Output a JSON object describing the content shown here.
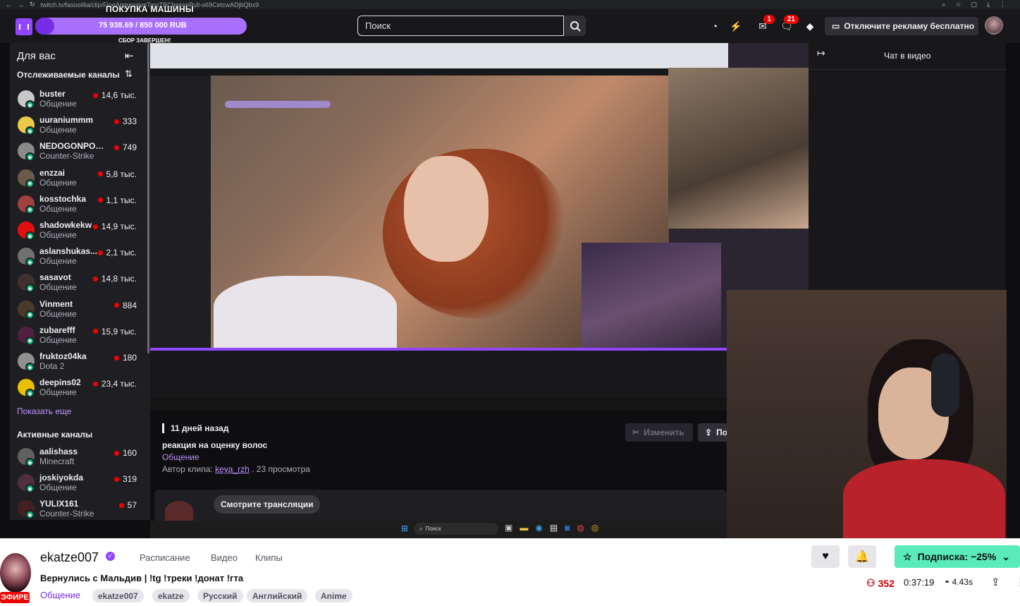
{
  "browser": {
    "url": "twitch.tv/fasooillia/clip/FineAggressiveTaroTBCheesePull-o69CetcwADjbQbx9"
  },
  "topnav": {
    "goal_title": "ПОКУПКА МАШИНЫ",
    "goal_amount": "75 938.69 / 850 000 RUB",
    "goal_progress": 0.089,
    "goal_sub": "СБОР ЗАВЕРШЕН!",
    "search_placeholder": "Поиск",
    "inbox_count": "1",
    "notifications_count": "21",
    "ad_free_label": "Отключите рекламу бесплатно"
  },
  "sidebar": {
    "title": "Для вас",
    "followed_title": "Отслеживаемые каналы",
    "followed": [
      {
        "name": "buster",
        "category": "Общение",
        "viewers": "14,6 тыс.",
        "color": "#c8c8c8"
      },
      {
        "name": "uuraniummm",
        "category": "Общение",
        "viewers": "333",
        "color": "#e8c94a"
      },
      {
        "name": "NEDOGONPOLYA",
        "category": "Counter-Strike",
        "viewers": "749",
        "color": "#8a8a8a"
      },
      {
        "name": "enzzai",
        "category": "Общение",
        "viewers": "5,8 тыс.",
        "color": "#6b5a4a"
      },
      {
        "name": "kosstochka",
        "category": "Общение",
        "viewers": "1,1 тыс.",
        "color": "#a04040"
      },
      {
        "name": "shadowkekw",
        "category": "Общение",
        "viewers": "14,9 тыс.",
        "color": "#e01010"
      },
      {
        "name": "aslanshukas...",
        "category": "Общение",
        "viewers": "2,1 тыс.",
        "color": "#707070"
      },
      {
        "name": "sasavot",
        "category": "Общение",
        "viewers": "14,8 тыс.",
        "color": "#403030"
      },
      {
        "name": "Vinment",
        "category": "Общение",
        "viewers": "884",
        "color": "#4a3a2a"
      },
      {
        "name": "zubarefff",
        "category": "Общение",
        "viewers": "15,9 тыс.",
        "color": "#502040"
      },
      {
        "name": "fruktoz04ka",
        "category": "Dota 2",
        "viewers": "180",
        "color": "#909090"
      },
      {
        "name": "deepins02",
        "category": "Общение",
        "viewers": "23,4 тыс.",
        "color": "#e8c000"
      }
    ],
    "show_more": "Показать еще",
    "active_title": "Активные каналы",
    "active": [
      {
        "name": "aalishass",
        "category": "Minecraft",
        "viewers": "160",
        "color": "#606060"
      },
      {
        "name": "joskiyokda",
        "category": "Общение",
        "viewers": "319",
        "color": "#503040"
      },
      {
        "name": "YULIX161",
        "category": "Counter-Strike",
        "viewers": "57",
        "color": "#402020"
      }
    ]
  },
  "chat": {
    "title": "Чат в видео"
  },
  "clip": {
    "date": "11 дней назад",
    "title": "реакция на оценку волос",
    "category": "Общение",
    "author_prefix": "Автор клипа: ",
    "author": "keya_rzh",
    "views": " . 23 просмотра",
    "edit_label": "Изменить",
    "share_label": "По",
    "watch_label": "Смотрите трансляции"
  },
  "taskbar": {
    "search_label": "Поиск"
  },
  "channel": {
    "name": "ekatze007",
    "tabs": [
      "Расписание",
      "Видео",
      "Клипы"
    ],
    "stream_title": "Вернулись с Мальдив | !tg !треки !донат !гта",
    "category": "Общение",
    "tags": [
      "ekatze007",
      "ekatze",
      "Русский",
      "Английский",
      "Anime"
    ],
    "live_label": "ЭФИРЕ",
    "subscribe_label": "Подписка: −25%",
    "viewers": "352",
    "uptime": "0:37:19",
    "latency": "4.43s"
  },
  "colors": {
    "accent": "#9147ff",
    "live": "#eb0400",
    "subscribe": "#5aebbb"
  }
}
